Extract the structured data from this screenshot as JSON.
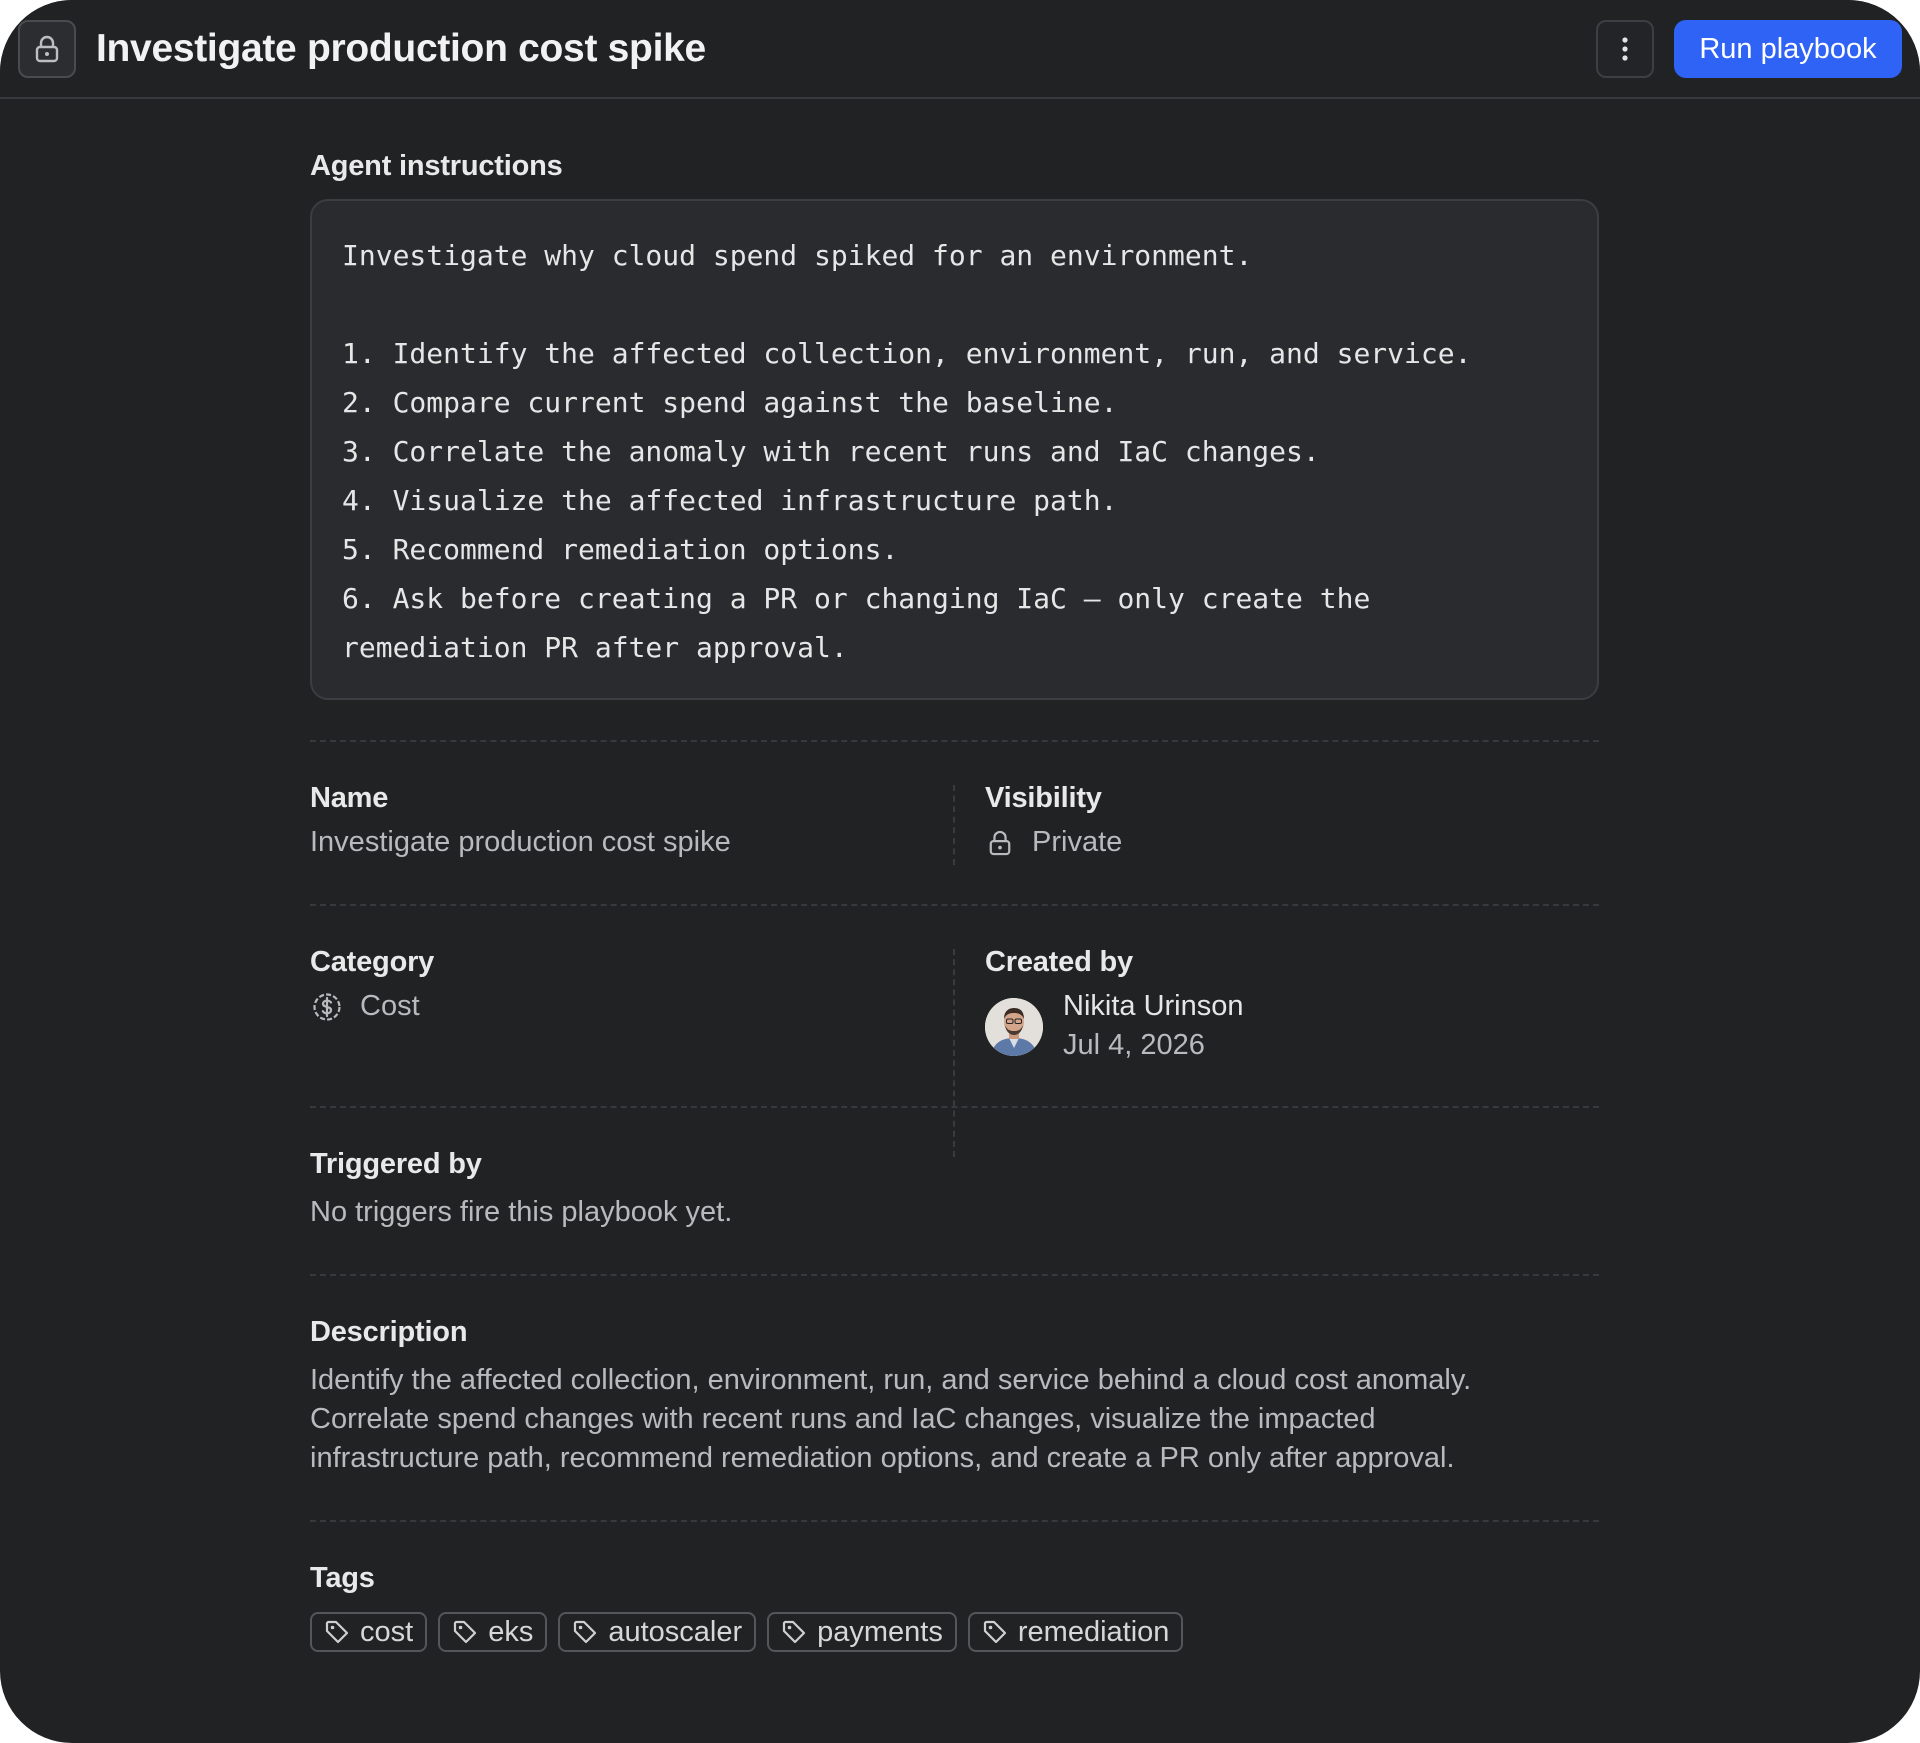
{
  "header": {
    "title": "Investigate production cost spike",
    "run_button": "Run playbook",
    "lock_icon": "lock-icon",
    "more_icon": "more-vertical-icon"
  },
  "instructions": {
    "label": "Agent instructions",
    "lines": [
      "Investigate why cloud spend spiked for an environment.",
      "",
      "1. Identify the affected collection, environment, run, and service.",
      "2. Compare current spend against the baseline.",
      "3. Correlate the anomaly with recent runs and IaC changes.",
      "4. Visualize the affected infrastructure path.",
      "5. Recommend remediation options.",
      "6. Ask before creating a PR or changing IaC — only create the",
      "remediation PR after approval."
    ]
  },
  "name": {
    "label": "Name",
    "value": "Investigate production cost spike"
  },
  "visibility": {
    "label": "Visibility",
    "value": "Private",
    "icon": "lock-icon"
  },
  "category": {
    "label": "Category",
    "value": "Cost",
    "icon": "dollar-circle-icon"
  },
  "created_by": {
    "label": "Created by",
    "name": "Nikita Urinson",
    "date": "Jul 4, 2026"
  },
  "triggered_by": {
    "label": "Triggered by",
    "value": "No triggers fire this playbook yet."
  },
  "description": {
    "label": "Description",
    "lines": [
      "Identify the affected collection, environment, run, and service behind a cloud cost anomaly.",
      "Correlate spend changes with recent runs and IaC changes, visualize the impacted",
      "infrastructure path, recommend remediation options, and create a PR only after approval."
    ]
  },
  "tags": {
    "label": "Tags",
    "items": [
      "cost",
      "eks",
      "autoscaler",
      "payments",
      "remediation"
    ],
    "icon": "tag-icon"
  },
  "colors": {
    "background": "#212224",
    "accent": "#2f63f6",
    "code_background": "#2a2b2e"
  }
}
